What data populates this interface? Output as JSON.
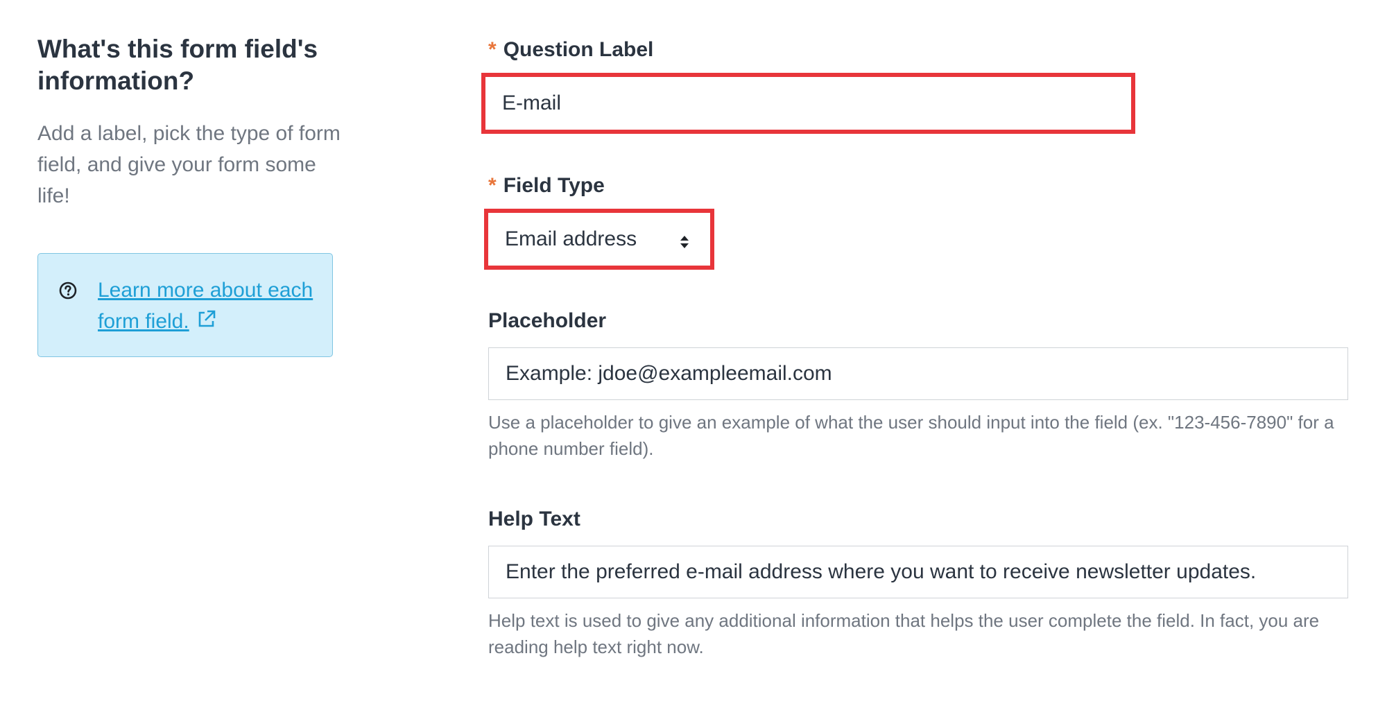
{
  "intro": {
    "title": "What's this form field's information?",
    "description": "Add a label, pick the type of form field, and give your form some life!",
    "link_text": "Learn more about each form field.",
    "help_icon": "question-circle-icon",
    "external_icon": "external-link-icon"
  },
  "question_label": {
    "required_mark": "*",
    "label": "Question Label",
    "value": "E-mail"
  },
  "field_type": {
    "required_mark": "*",
    "label": "Field Type",
    "selected": "Email address",
    "arrow_icon": "select-arrows-icon"
  },
  "placeholder": {
    "label": "Placeholder",
    "value": "Example: jdoe@exampleemail.com",
    "hint": "Use a placeholder to give an example of what the user should input into the field (ex. \"123-456-7890\" for a phone number field)."
  },
  "help_text": {
    "label": "Help Text",
    "value": "Enter the preferred e-mail address where you want to receive newsletter updates.",
    "hint": "Help text is used to give any additional information that helps the user complete the field. In fact, you are reading help text right now."
  },
  "colors": {
    "required": "#e8753a",
    "highlight": "#e8353a",
    "link": "#1e9fd6",
    "info_bg": "#d3effb"
  }
}
